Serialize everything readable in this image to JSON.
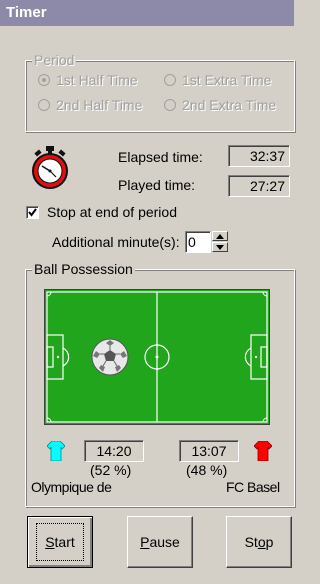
{
  "window": {
    "title": "Timer"
  },
  "period": {
    "legend": "Period",
    "options": [
      {
        "label": "1st Half Time",
        "selected": true
      },
      {
        "label": "1st Extra Time",
        "selected": false
      },
      {
        "label": "2nd Half Time",
        "selected": false
      },
      {
        "label": "2nd Extra Time",
        "selected": false
      }
    ]
  },
  "times": {
    "elapsed_label": "Elapsed time:",
    "elapsed_value": "32:37",
    "played_label": "Played time:",
    "played_value": "27:27"
  },
  "stop_at_end": {
    "label": "Stop at end of period",
    "checked": true
  },
  "additional": {
    "label": "Additional minute(s):",
    "value": "0"
  },
  "possession": {
    "legend": "Ball Possession",
    "home": {
      "time": "14:20",
      "percent": "(52 %)",
      "team": "Olympique de",
      "shirt_color": "#00ffff"
    },
    "away": {
      "time": "13:07",
      "percent": "(48 %)",
      "team": "FC Basel",
      "shirt_color": "#ff0000"
    },
    "pitch_color": "#21a51c"
  },
  "buttons": {
    "start": {
      "accel": "S",
      "rest": "tart"
    },
    "pause": {
      "accel": "P",
      "rest": "ause"
    },
    "stop": {
      "pre": "St",
      "accel": "o",
      "rest": "p"
    }
  }
}
